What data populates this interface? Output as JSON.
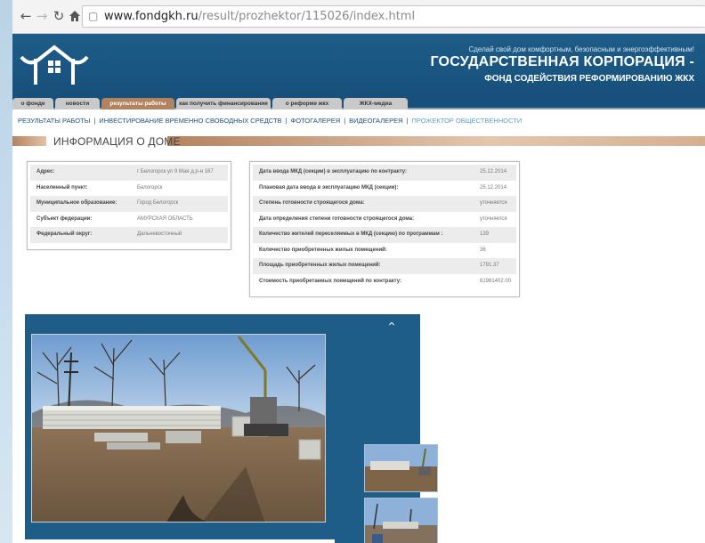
{
  "browser": {
    "back_icon": "arrow-left-icon",
    "forward_icon": "arrow-right-icon",
    "reload_icon": "reload-icon",
    "home_icon": "home-icon",
    "url_host": "www.fondgkh.ru",
    "url_path": "/result/prozhektor/115026/index.html"
  },
  "header": {
    "slogan": "Сделай свой дом комфортным, безопасным и энергоэффективным!",
    "title": "ГОСУДАРСТВЕННАЯ КОРПОРАЦИЯ -",
    "subtitle": "ФОНД СОДЕЙСТВИЯ РЕФОРМИРОВАНИЮ ЖКХ"
  },
  "tabs": [
    {
      "label": "о фонде"
    },
    {
      "label": "новости"
    },
    {
      "label": "результаты работы"
    },
    {
      "label": "как получить финансирование"
    },
    {
      "label": "о реформе жкх"
    },
    {
      "label": "ЖКХ-медиа"
    }
  ],
  "sub_nav": [
    {
      "label": "РЕЗУЛЬТАТЫ РАБОТЫ"
    },
    {
      "label": "ИНВЕСТИРОВАНИЕ ВРЕМЕННО СВОБОДНЫХ СРЕДСТВ"
    },
    {
      "label": "ФОТОГАЛЕРЕЯ"
    },
    {
      "label": "ВИДЕОГАЛЕРЕЯ"
    },
    {
      "label": "ПРОЖЕКТОР ОБЩЕСТВЕННОСТИ"
    }
  ],
  "section": {
    "title": "ИНФОРМАЦИЯ О ДОМЕ"
  },
  "address_info": [
    {
      "key": "Адрес:",
      "value": "г Белогорск ул 9 Мая д.р-н 167"
    },
    {
      "key": "Населенный пункт:",
      "value": "Белогорск"
    },
    {
      "key": "Муниципальное образование:",
      "value": "Город Белогорск"
    },
    {
      "key": "Субъект федерации:",
      "value": "АМУРСКАЯ ОБЛАСТЬ"
    },
    {
      "key": "Федеральный округ:",
      "value": "Дальневосточный"
    }
  ],
  "house_info": [
    {
      "key": "Дата ввода МКД (секции) в эксплуатацию по контракту:",
      "value": "25.12.2014"
    },
    {
      "key": "Плановая дата ввода в эксплуатацию МКД (секции):",
      "value": "25.12.2014"
    },
    {
      "key": "Степень готовности строящегося дома:",
      "value": "уточняется"
    },
    {
      "key": "Дата определения степени готовности строящегося дома:",
      "value": "уточняется"
    },
    {
      "key": "Количество жителей переселяемых в МКД (секцию) по программам :",
      "value": "139"
    },
    {
      "key": "Количество приобретенных жилых помещений:",
      "value": "36"
    },
    {
      "key": "Площадь приобретенных жилых помещений:",
      "value": "1791.37"
    },
    {
      "key": "Стоимость приобретаемых помещений по контракту:",
      "value": "61981402.00"
    }
  ],
  "gallery": {
    "scroll_up_icon": "chevron-up-icon"
  }
}
